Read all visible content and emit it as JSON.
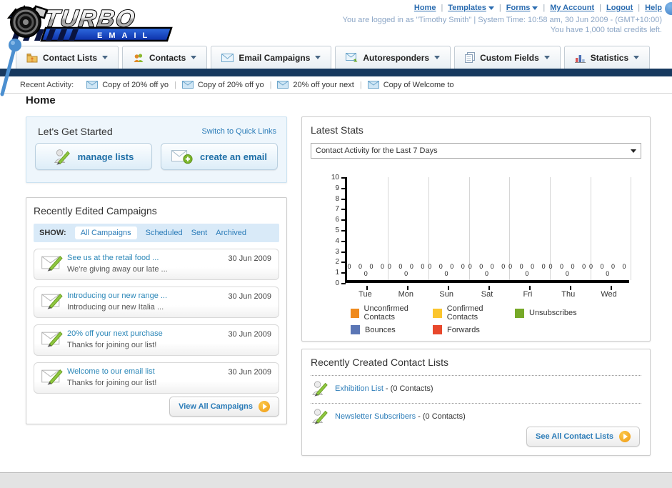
{
  "ui": {
    "separator": "|"
  },
  "header": {
    "logo_brand": "TURBO",
    "logo_sub": "EMAIL",
    "links": [
      {
        "label": "Home"
      },
      {
        "label": "Templates"
      },
      {
        "label": "Forms"
      },
      {
        "label": "My Account"
      },
      {
        "label": "Logout"
      },
      {
        "label": "Help"
      }
    ],
    "login_line": "You are logged in as \"Timothy Smith\" | System Time: 10:58 am, 30 Jun 2009 - (GMT+10:00)",
    "credits_line": "You have 1,000 total credits left."
  },
  "nav_tabs": [
    {
      "label": "Contact Lists"
    },
    {
      "label": "Contacts"
    },
    {
      "label": "Email Campaigns"
    },
    {
      "label": "Autoresponders"
    },
    {
      "label": "Custom Fields"
    },
    {
      "label": "Statistics"
    }
  ],
  "recent_activity": {
    "label": "Recent Activity:",
    "items": [
      {
        "text": "Copy of 20% off yo"
      },
      {
        "text": "Copy of 20% off yo"
      },
      {
        "text": "20% off your next"
      },
      {
        "text": "Copy of Welcome to"
      }
    ]
  },
  "page": {
    "heading": "Home"
  },
  "get_started": {
    "title": "Let's Get Started",
    "switch_link": "Switch to Quick Links",
    "buttons": [
      {
        "label": "manage lists"
      },
      {
        "label": "create an email"
      }
    ]
  },
  "campaigns": {
    "title": "Recently Edited Campaigns",
    "show_label": "SHOW:",
    "tabs": [
      {
        "label": "All Campaigns"
      },
      {
        "label": "Scheduled"
      },
      {
        "label": "Sent"
      },
      {
        "label": "Archived"
      }
    ],
    "rows": [
      {
        "title": "See us at the retail food ...",
        "subtitle": "We're giving away our late ...",
        "date": "30 Jun 2009"
      },
      {
        "title": "Introducing our new range ...",
        "subtitle": "Introducing our new Italia ...",
        "date": "30 Jun 2009"
      },
      {
        "title": "20% off your next purchase",
        "subtitle": "Thanks for joining our list!",
        "date": "30 Jun 2009"
      },
      {
        "title": "Welcome to our email list",
        "subtitle": "Thanks for joining our list!",
        "date": "30 Jun 2009"
      }
    ],
    "view_all_label": "View All Campaigns"
  },
  "stats": {
    "title": "Latest Stats",
    "dropdown_value": "Contact Activity for the Last 7 Days",
    "zero_row": "0 0 0 0 0"
  },
  "chart_data": {
    "type": "bar",
    "title": "Contact Activity for the Last 7 Days",
    "categories": [
      "Tue",
      "Mon",
      "Sun",
      "Sat",
      "Fri",
      "Thu",
      "Wed"
    ],
    "series": [
      {
        "name": "Unconfirmed Contacts",
        "color": "#ef8a1d",
        "values": [
          0,
          0,
          0,
          0,
          0,
          0,
          0
        ]
      },
      {
        "name": "Confirmed Contacts",
        "color": "#fbc52d",
        "values": [
          0,
          0,
          0,
          0,
          0,
          0,
          0
        ]
      },
      {
        "name": "Unsubscribes",
        "color": "#76a928",
        "values": [
          0,
          0,
          0,
          0,
          0,
          0,
          0
        ]
      },
      {
        "name": "Bounces",
        "color": "#5b76b5",
        "values": [
          0,
          0,
          0,
          0,
          0,
          0,
          0
        ]
      },
      {
        "name": "Forwards",
        "color": "#e8482c",
        "values": [
          0,
          0,
          0,
          0,
          0,
          0,
          0
        ]
      }
    ],
    "ylim": [
      0,
      10
    ],
    "yticks": [
      0,
      1,
      2,
      3,
      4,
      5,
      6,
      7,
      8,
      9,
      10
    ],
    "grid": true,
    "legend_position": "bottom"
  },
  "contact_lists": {
    "title": "Recently Created Contact Lists",
    "rows": [
      {
        "name": "Exhibition List",
        "suffix": " - (0 Contacts)"
      },
      {
        "name": "Newsletter Subscribers",
        "suffix": " - (0 Contacts)"
      }
    ],
    "see_all_label": "See All Contact Lists"
  }
}
